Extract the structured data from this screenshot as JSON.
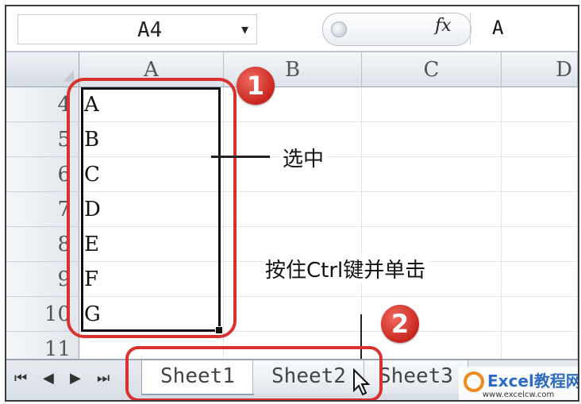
{
  "formula_bar": {
    "name_box": "A4",
    "dropdown_glyph": "▾",
    "fx_label": "fx",
    "value": "A"
  },
  "columns": [
    "A",
    "B",
    "C",
    "D"
  ],
  "rows": [
    "4",
    "5",
    "6",
    "7",
    "8",
    "9",
    "10",
    "11"
  ],
  "column_a_values": [
    "A",
    "B",
    "C",
    "D",
    "E",
    "F",
    "G",
    ""
  ],
  "annotations": {
    "badge1": "1",
    "badge2": "2",
    "select_label": "选中",
    "ctrl_click_label": "按住Ctrl键并单击"
  },
  "sheet_nav": [
    "⏮",
    "◀",
    "▶",
    "⏭"
  ],
  "sheet_tabs": [
    {
      "label": "Sheet1",
      "active": true
    },
    {
      "label": "Sheet2",
      "active": false
    },
    {
      "label": "Sheet3",
      "active": false
    }
  ],
  "watermark": {
    "text": "Excel教程网",
    "url": "www.excelcw.com"
  },
  "colors": {
    "annotation_red": "#d9312e",
    "header_bg": "#dde3ea"
  }
}
